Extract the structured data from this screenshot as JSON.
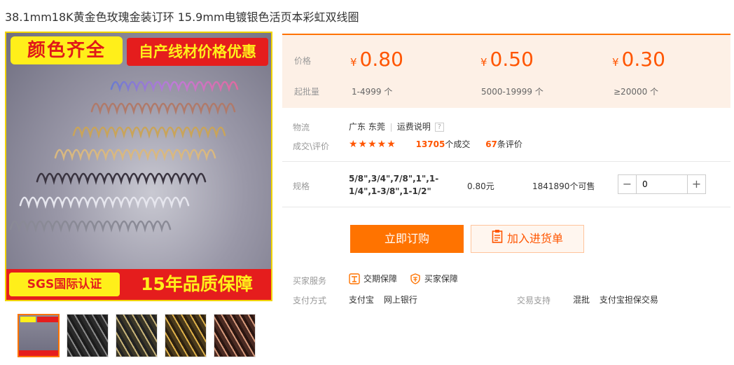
{
  "product": {
    "title": "38.1mm18K黄金色玫瑰金装订环 15.9mm电镀银色活页本彩虹双线圈"
  },
  "main_image": {
    "badge_colors": "颜色齐全",
    "badge_price": "自产线材价格优惠",
    "badge_sgs": "SGS国际认证",
    "badge_quality": "15年品质保障"
  },
  "thumbnails": [
    {
      "name": "thumb-1"
    },
    {
      "name": "thumb-2"
    },
    {
      "name": "thumb-3"
    },
    {
      "name": "thumb-4"
    },
    {
      "name": "thumb-5"
    }
  ],
  "price_table": {
    "price_label": "价格",
    "moq_label": "起批量",
    "currency": "¥",
    "tiers": [
      {
        "price": "0.80",
        "range": "1-4999 个"
      },
      {
        "price": "0.50",
        "range": "5000-19999 个"
      },
      {
        "price": "0.30",
        "range": "≥20000 个"
      }
    ]
  },
  "logistics": {
    "label": "物流",
    "location": "广东 东莞",
    "shipping_link": "运费说明",
    "help_icon": "?"
  },
  "deals": {
    "label": "成交\\评价",
    "stars": "★★★★★",
    "deal_count": "13705",
    "deal_suffix": "个成交",
    "review_count": "67",
    "review_suffix": "条评价"
  },
  "spec": {
    "label": "规格",
    "value": "5/8\",3/4\",7/8\",1\",1-1/4\",1-3/8\",1-1/2\"",
    "price": "0.80元",
    "stock": "1841890个可售",
    "quantity": "0",
    "minus": "−",
    "plus": "+"
  },
  "actions": {
    "buy_now": "立即订购",
    "add_to_cart": "加入进货单"
  },
  "services": {
    "label": "买家服务",
    "items": [
      "交期保障",
      "买家保障"
    ]
  },
  "payment": {
    "label": "支付方式",
    "methods": [
      "支付宝",
      "网上银行"
    ]
  },
  "trade_support": {
    "label": "交易支持",
    "items": [
      "混批",
      "支付宝担保交易"
    ]
  },
  "colors": {
    "accent": "#ff7300",
    "price": "#ff5500",
    "price_bg": "#fdf0e6"
  }
}
